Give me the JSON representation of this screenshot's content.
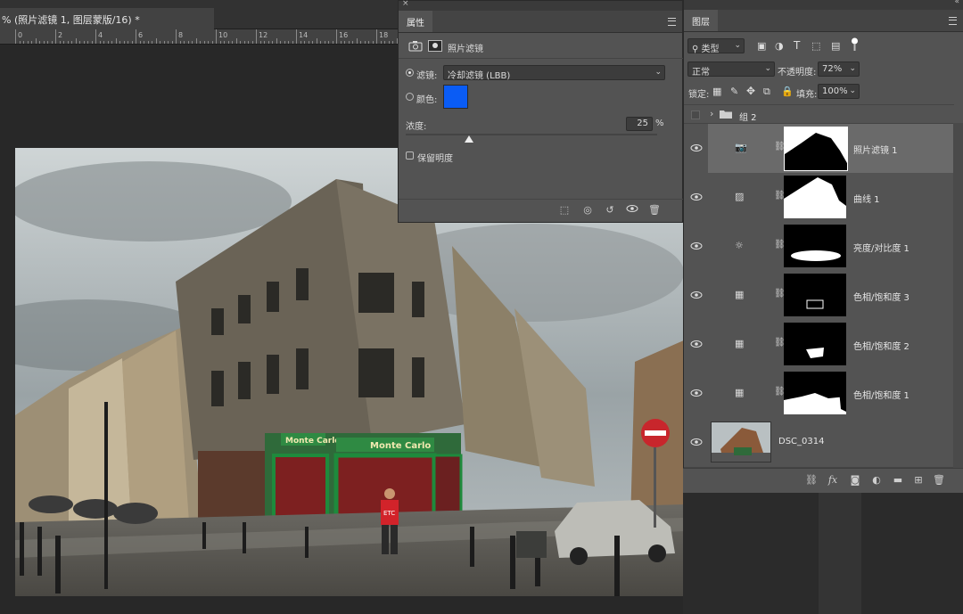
{
  "document": {
    "tab_title": "% (照片滤镜 1, 图层蒙版/16) *",
    "ruler_labels": [
      "0",
      "2",
      "4",
      "6",
      "8",
      "10",
      "12",
      "14",
      "16",
      "18"
    ]
  },
  "properties": {
    "tab_label": "属性",
    "header_label": "照片滤镜",
    "filter_label": "滤镜:",
    "filter_value": "冷却滤镜 (LBB)",
    "color_label": "颜色:",
    "color_swatch": "#0a5cf5",
    "density_label": "浓度:",
    "density_value": "25",
    "density_unit": "%",
    "density_level": 25,
    "preserve_luminosity_label": "保留明度"
  },
  "layers_panel": {
    "tab_label": "图层",
    "filter_kind": "类型",
    "blend_mode": "正常",
    "opacity_label": "不透明度:",
    "opacity_value": "72%",
    "lock_label": "锁定:",
    "fill_label": "填充:",
    "fill_value": "100%",
    "group_name": "组 2",
    "layers": [
      {
        "name": "照片滤镜 1",
        "icon": "camera-icon",
        "selected": true
      },
      {
        "name": "曲线 1",
        "icon": "curves-icon",
        "selected": false
      },
      {
        "name": "亮度/对比度 1",
        "icon": "brightness-icon",
        "selected": false
      },
      {
        "name": "色相/饱和度 3",
        "icon": "hue-saturation-icon",
        "selected": false
      },
      {
        "name": "色相/饱和度 2",
        "icon": "hue-saturation-icon",
        "selected": false
      },
      {
        "name": "色相/饱和度 1",
        "icon": "hue-saturation-icon",
        "selected": false
      },
      {
        "name": "DSC_0314",
        "icon": "image-thumbnail",
        "selected": false
      }
    ]
  },
  "photo": {
    "store_sign": "Monte Carlo",
    "store_sign_left": "Monte Carlo",
    "shirt_text": "ETC"
  }
}
